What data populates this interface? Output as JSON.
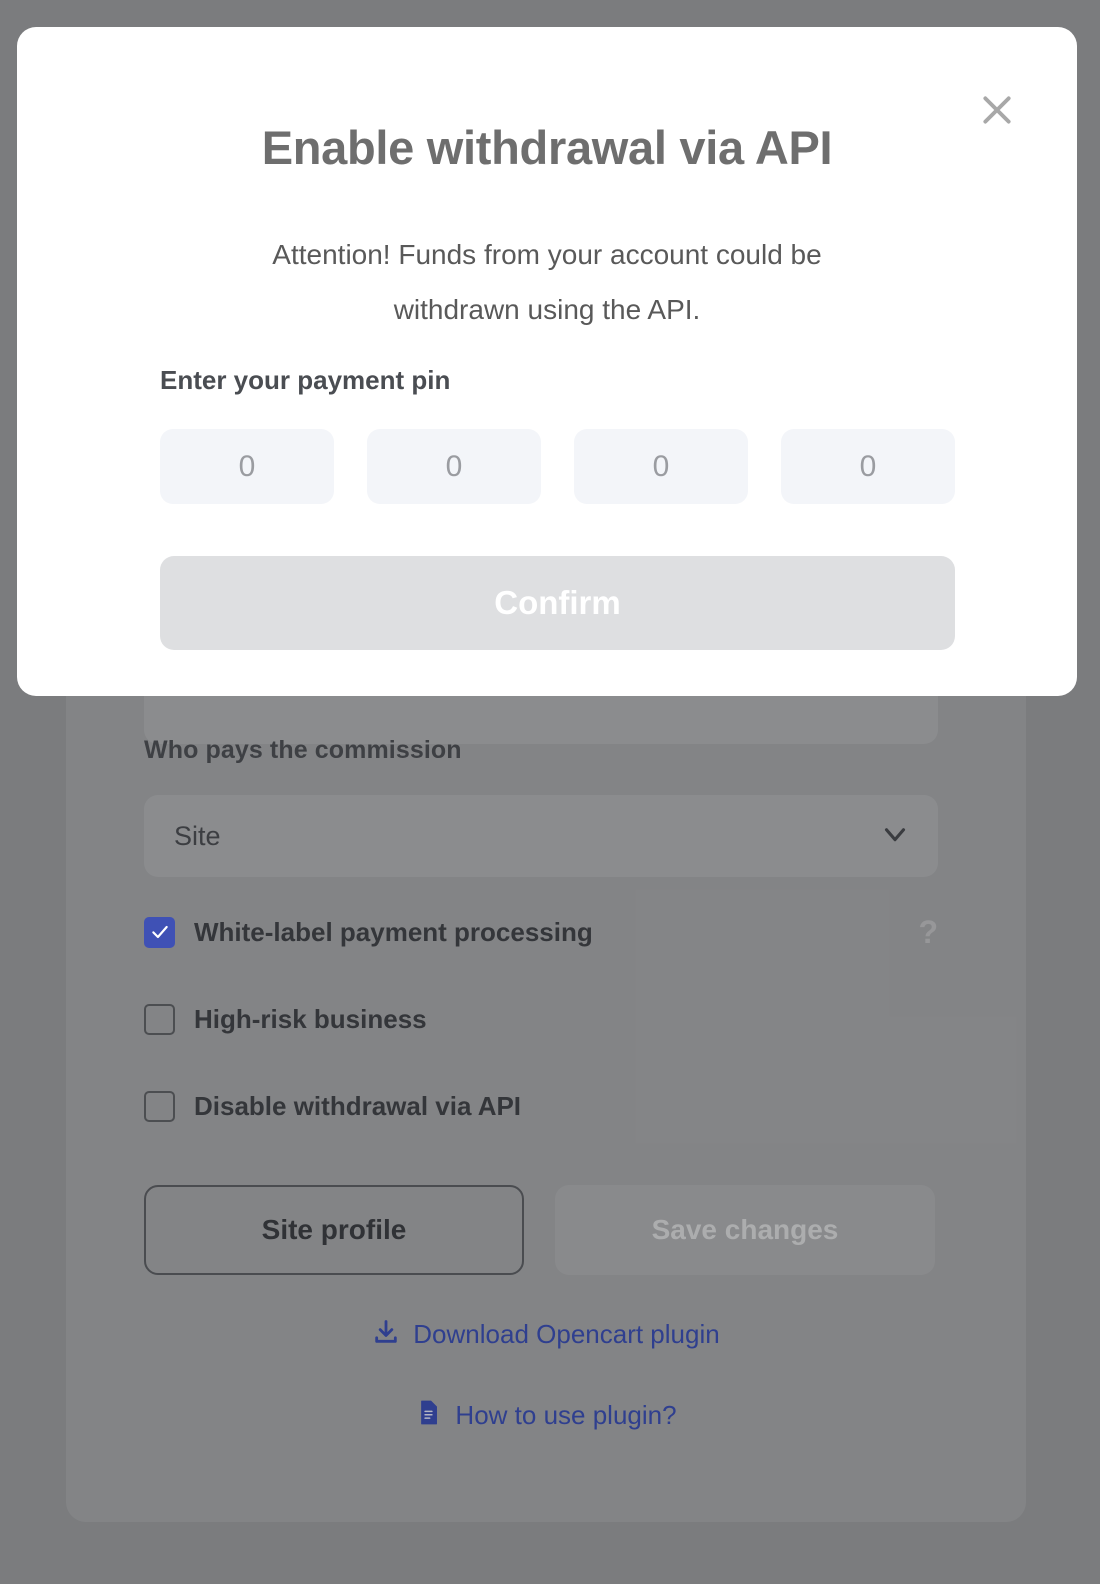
{
  "modal": {
    "title": "Enable withdrawal via API",
    "message": "Attention! Funds from your account could be withdrawn using the API.",
    "pin_label": "Enter your payment pin",
    "pin_placeholder": "0",
    "pin_fields": 4,
    "pin_values": [
      "",
      "",
      "",
      ""
    ],
    "confirm_label": "Confirm",
    "close_icon": "close-icon",
    "confirm_disabled": true,
    "colors": {
      "surface": "#ffffff",
      "title_text": "#6e6e6e",
      "body_text": "#595959",
      "pin_field_bg": "#f3f5f9",
      "confirm_bg": "#dedfe1",
      "confirm_text": "#ffffff",
      "close_icon": "#a8a8a8"
    }
  },
  "overlay": {
    "color": "#7b7c7e"
  },
  "background_form": {
    "commission_label": "Who pays the commission",
    "commission_value": "Site",
    "commission_icon": "chevron-down-icon",
    "checkboxes": [
      {
        "label": "White-label payment processing",
        "checked": true,
        "help_icon": "question-mark-icon",
        "help_glyph": "?"
      },
      {
        "label": "High-risk business",
        "checked": false
      },
      {
        "label": "Disable withdrawal via API",
        "checked": false
      }
    ],
    "buttons": {
      "site_profile": "Site profile",
      "save_changes": "Save changes"
    },
    "links": [
      {
        "label": "Download Opencart plugin",
        "icon": "download-icon"
      },
      {
        "label": "How to use plugin?",
        "icon": "document-icon"
      }
    ],
    "colors": {
      "checkbox_checked": "#3f51b5",
      "link_text": "#2f3f8f"
    }
  }
}
